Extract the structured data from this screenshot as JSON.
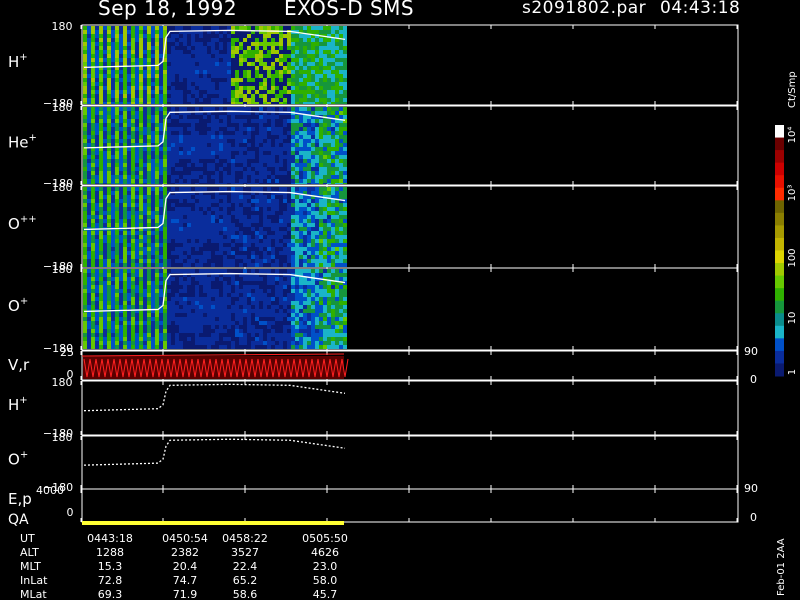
{
  "header": {
    "date": "Sep 18, 1992",
    "mission": "EXOS-D SMS",
    "file": "s2091802.par",
    "time": "04:43:18"
  },
  "colorbar": {
    "unit": "Ct/Smp",
    "ticks": [
      "10⁴",
      "10³",
      "100",
      "10",
      "1"
    ],
    "colors": [
      "#ffffff",
      "#6a0000",
      "#9c0000",
      "#cc0000",
      "#e81000",
      "#ff2b00",
      "#6e6400",
      "#8a7e00",
      "#a69a00",
      "#c2b400",
      "#dcd400",
      "#a0c800",
      "#66c800",
      "#2fb000",
      "#16963c",
      "#0a8c8c",
      "#1ab4c8",
      "#0050c8",
      "#0a2d9c",
      "#0a1a70"
    ]
  },
  "chart_data": {
    "type": "heatmap",
    "panels": [
      {
        "id": "h-plus",
        "label": "H",
        "sup": "+",
        "ymax": "180",
        "ymin": "−180"
      },
      {
        "id": "he-plus",
        "label": "He",
        "sup": "+",
        "ymax": "180",
        "ymin": "−180"
      },
      {
        "id": "o-plus-plus",
        "label": "O",
        "sup": "++",
        "ymax": "180",
        "ymin": "−180"
      },
      {
        "id": "o-plus",
        "label": "O",
        "sup": "+",
        "ymax": "180",
        "ymin": "−180"
      }
    ],
    "vr_panel": {
      "label": "V,r",
      "ymax": "25",
      "ymin": "0",
      "right_top": "90",
      "right_bottom": "0"
    },
    "line_panels": [
      {
        "id": "h-plus-line",
        "label": "H",
        "sup": "+",
        "ymax": "180",
        "ymin": "−180"
      },
      {
        "id": "o-plus-line",
        "label": "O",
        "sup": "+",
        "ymax": "180",
        "ymin": "−180"
      }
    ],
    "ep_panel": {
      "label": "E,p",
      "ymax": "4000",
      "ymin": "0",
      "right_top": "90",
      "right_bottom": "0"
    },
    "qa_label": "QA",
    "side_label": "Feb-01 2AA"
  },
  "axis_table": {
    "headers": [
      "UT",
      "ALT",
      "MLT",
      "InLat",
      "MLat"
    ],
    "columns": [
      [
        "0443:18",
        "1288",
        "15.3",
        "72.8",
        "69.3"
      ],
      [
        "0450:54",
        "2382",
        "20.4",
        "74.7",
        "71.9"
      ],
      [
        "0458:22",
        "3527",
        "22.4",
        "65.2",
        "58.6"
      ],
      [
        "0505:50",
        "4626",
        "23.0",
        "58.0",
        "45.7"
      ]
    ]
  }
}
